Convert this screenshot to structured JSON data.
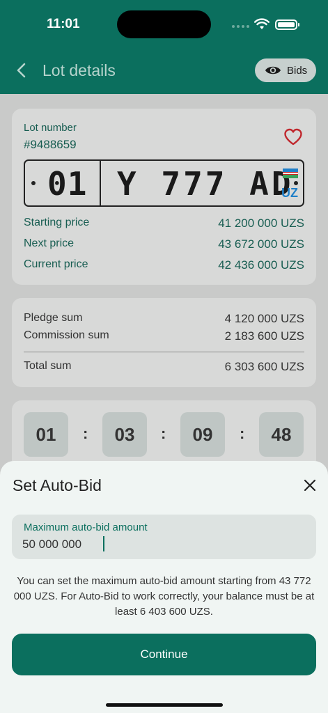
{
  "status_bar": {
    "time": "11:01"
  },
  "header": {
    "title": "Lot details",
    "bids_label": "Bids"
  },
  "lot": {
    "number_label": "Lot number",
    "number": "#9488659",
    "plate": {
      "region": "01",
      "main": "Y 777 AD",
      "country": "UZ"
    },
    "prices": [
      {
        "label": "Starting price",
        "value": "41 200 000 UZS"
      },
      {
        "label": "Next price",
        "value": "43 672 000 UZS"
      },
      {
        "label": "Current price",
        "value": "42 436 000 UZS"
      }
    ]
  },
  "sums": {
    "items": [
      {
        "label": "Pledge sum",
        "value": "4 120 000 UZS"
      },
      {
        "label": "Commission sum",
        "value": "2 183 600 UZS"
      }
    ],
    "total": {
      "label": "Total sum",
      "value": "6 303 600 UZS"
    }
  },
  "timer": {
    "units": [
      "01",
      "03",
      "09",
      "48"
    ],
    "separator": ":"
  },
  "auto_bid": {
    "title": "Set Auto-Bid",
    "field_label": "Maximum auto-bid amount",
    "field_value": "50 000 000",
    "hint": "You can set the maximum auto-bid amount starting from 43 772 000 UZS. For Auto-Bid to work correctly, your balance must be at least 6 403 600 UZS.",
    "continue_label": "Continue"
  },
  "colors": {
    "primary": "#0b6f5e",
    "heart": "#c0272d",
    "flag_blue": "#1f7fc8",
    "flag_green": "#3aa15a"
  }
}
